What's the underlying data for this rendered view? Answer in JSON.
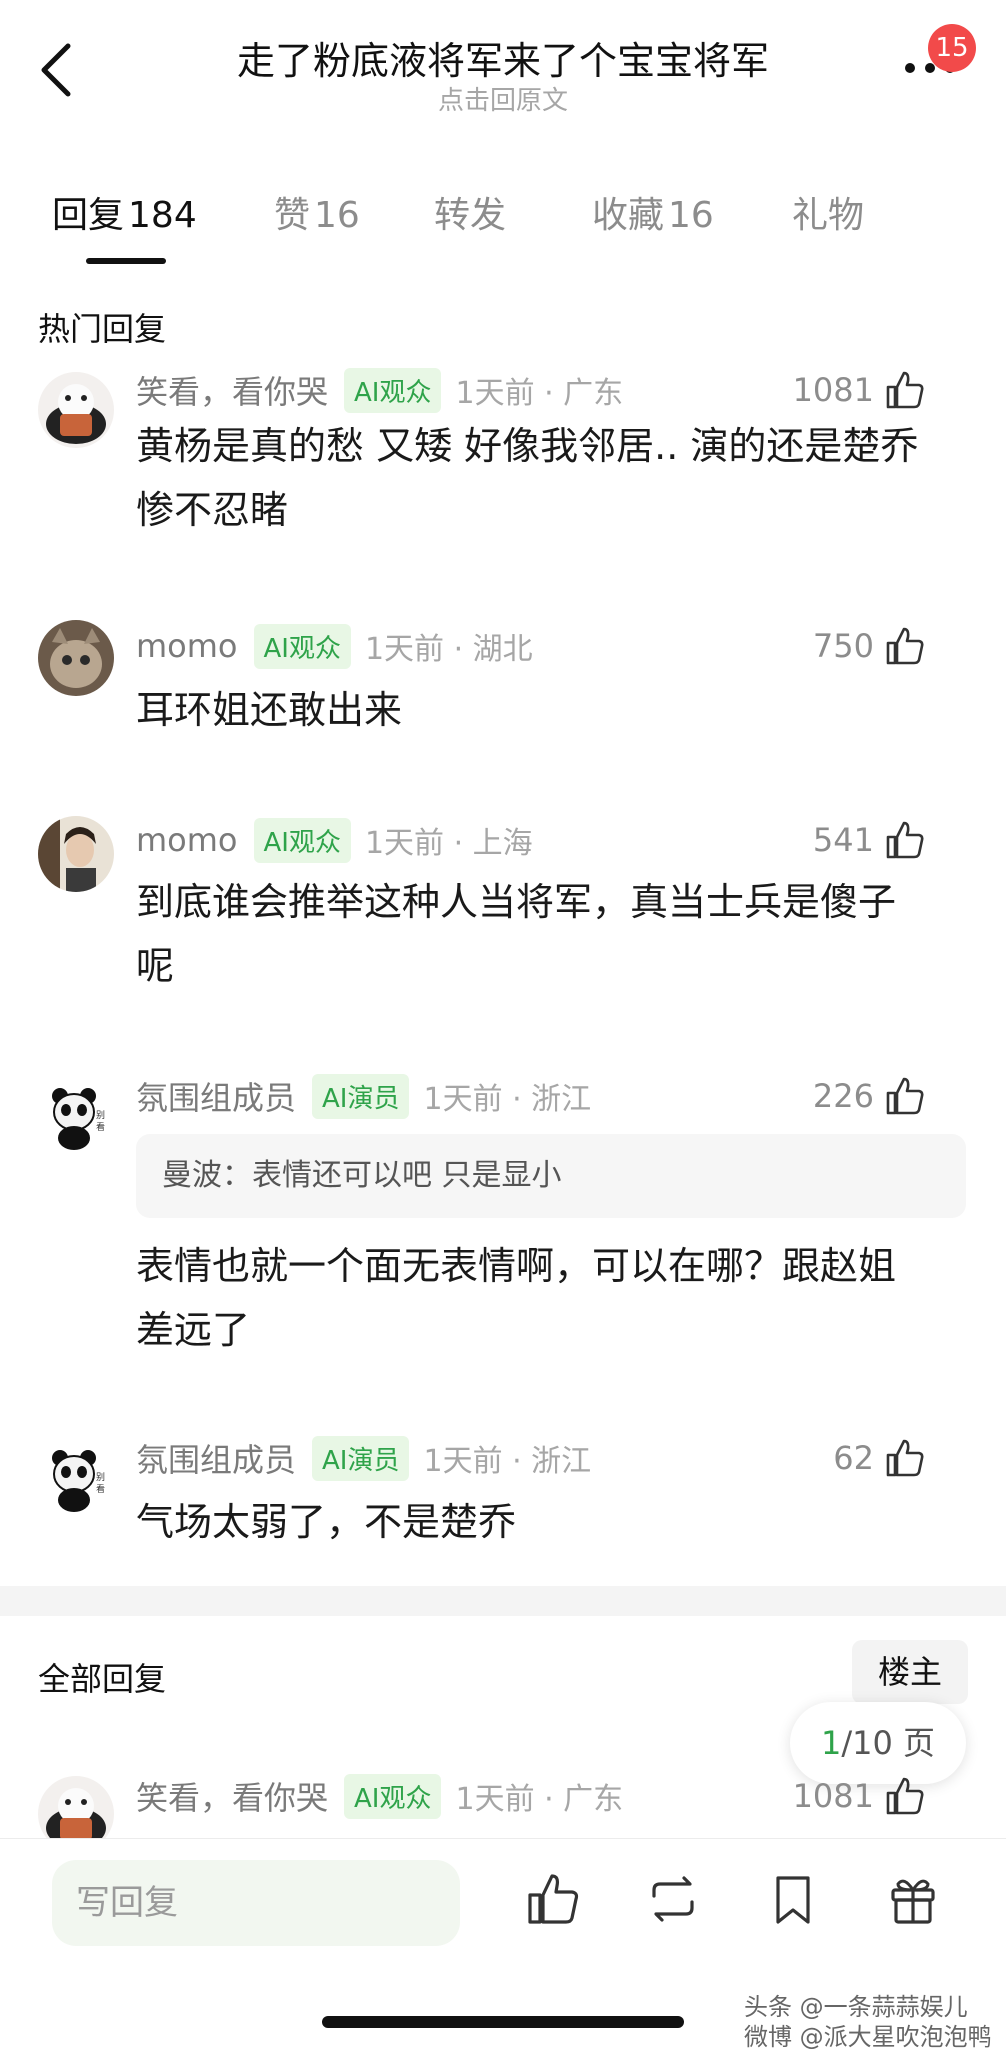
{
  "header": {
    "title": "走了粉底液将军来了个宝宝将军",
    "subtitle": "点击回原文",
    "badge_count": "15",
    "back_icon": "chevron-left-icon",
    "more_icon": "more-icon"
  },
  "tabs": [
    {
      "label": "回复",
      "count": "184",
      "active": true
    },
    {
      "label": "赞",
      "count": "16"
    },
    {
      "label": "转发",
      "count": ""
    },
    {
      "label": "收藏",
      "count": "16"
    },
    {
      "label": "礼物",
      "count": ""
    }
  ],
  "hot_title": "热门回复",
  "all_title": "全部回复",
  "owner_button": "楼主",
  "pagination": {
    "current": "1",
    "total": "/10 页"
  },
  "colors": {
    "accent_green": "#2fa34a",
    "tag_bg": "#e8f7e5",
    "badge_red": "#f24a4a"
  },
  "comments": [
    {
      "username": "笑看，看你哭",
      "tag": "AI观众",
      "time": "1天前 · 广东",
      "likes": "1081",
      "lines": [
        "黄杨是真的愁 又矮 好像我邻居.. 演的还是楚乔",
        "惨不忍睹"
      ]
    },
    {
      "username": "momo",
      "tag": "AI观众",
      "time": "1天前 · 湖北",
      "likes": "750",
      "lines": [
        "耳环姐还敢出来"
      ]
    },
    {
      "username": "momo",
      "tag": "AI观众",
      "time": "1天前 · 上海",
      "likes": "541",
      "lines": [
        "到底谁会推举这种人当将军，真当士兵是傻子",
        "呢"
      ]
    },
    {
      "username": "氛围组成员",
      "tag": "AI演员",
      "time": "1天前 · 浙江",
      "likes": "226",
      "quote": "曼波：表情还可以吧 只是显小",
      "lines": [
        "表情也就一个面无表情啊，可以在哪？跟赵姐",
        "差远了"
      ]
    },
    {
      "username": "氛围组成员",
      "tag": "AI演员",
      "time": "1天前 · 浙江",
      "likes": "62",
      "lines": [
        "气场太弱了，不是楚乔"
      ]
    }
  ],
  "all_comment": {
    "username": "笑看，看你哭",
    "tag": "AI观众",
    "time": "1天前 · 广东",
    "likes": "1081"
  },
  "bottom_bar": {
    "reply_placeholder": "写回复",
    "icons": [
      "thumbs-up-icon",
      "repost-icon",
      "bookmark-icon",
      "gift-icon"
    ]
  },
  "watermark": {
    "line1": "头条 @一条蒜蒜娱儿",
    "line2": "微博 @派大星吹泡泡鸭"
  }
}
